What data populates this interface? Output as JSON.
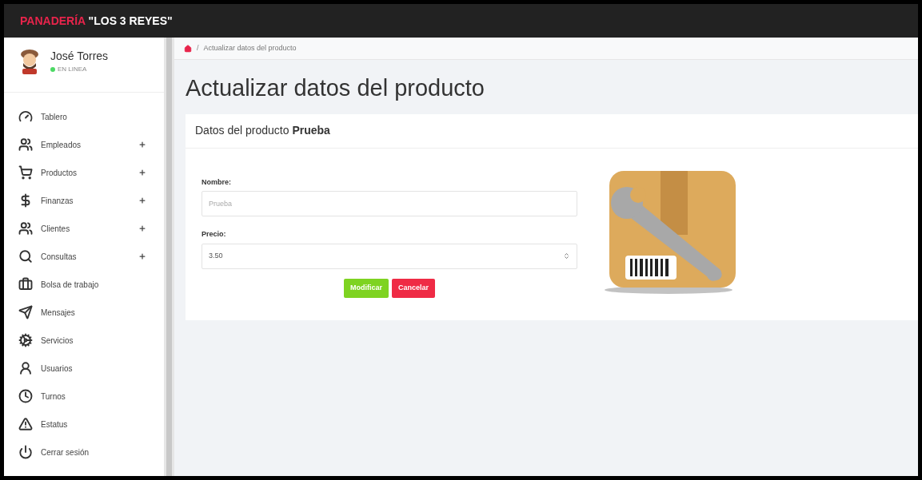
{
  "app": {
    "brand_red": "PANADERÍA",
    "brand_white": "\"LOS 3 REYES\""
  },
  "user": {
    "name": "José Torres",
    "status": "EN LINEA",
    "online": true
  },
  "sidebar": {
    "items": [
      {
        "label": "Tablero",
        "expandable": false
      },
      {
        "label": "Empleados",
        "expandable": true
      },
      {
        "label": "Productos",
        "expandable": true
      },
      {
        "label": "Finanzas",
        "expandable": true
      },
      {
        "label": "Clientes",
        "expandable": true
      },
      {
        "label": "Consultas",
        "expandable": true
      },
      {
        "label": "Bolsa de trabajo",
        "expandable": false
      },
      {
        "label": "Mensajes",
        "expandable": false
      },
      {
        "label": "Servicios",
        "expandable": false
      },
      {
        "label": "Usuarios",
        "expandable": false
      },
      {
        "label": "Turnos",
        "expandable": false
      },
      {
        "label": "Estatus",
        "expandable": false
      },
      {
        "label": "Cerrar sesión",
        "expandable": false
      }
    ]
  },
  "breadcrumb": {
    "separator": "/",
    "current": "Actualizar datos del producto"
  },
  "page_title": "Actualizar datos del producto",
  "card": {
    "title": "Datos del producto **Prueba**",
    "fields": [
      {
        "label": "Nombre:",
        "placeholder": "Prueba",
        "kind": "text"
      },
      {
        "label": "Precio:",
        "value": "3.50",
        "kind": "number"
      }
    ],
    "buttons": [
      {
        "label": "Modificar",
        "kind": "primary"
      },
      {
        "label": "Cancelar",
        "kind": "danger"
      }
    ]
  }
}
